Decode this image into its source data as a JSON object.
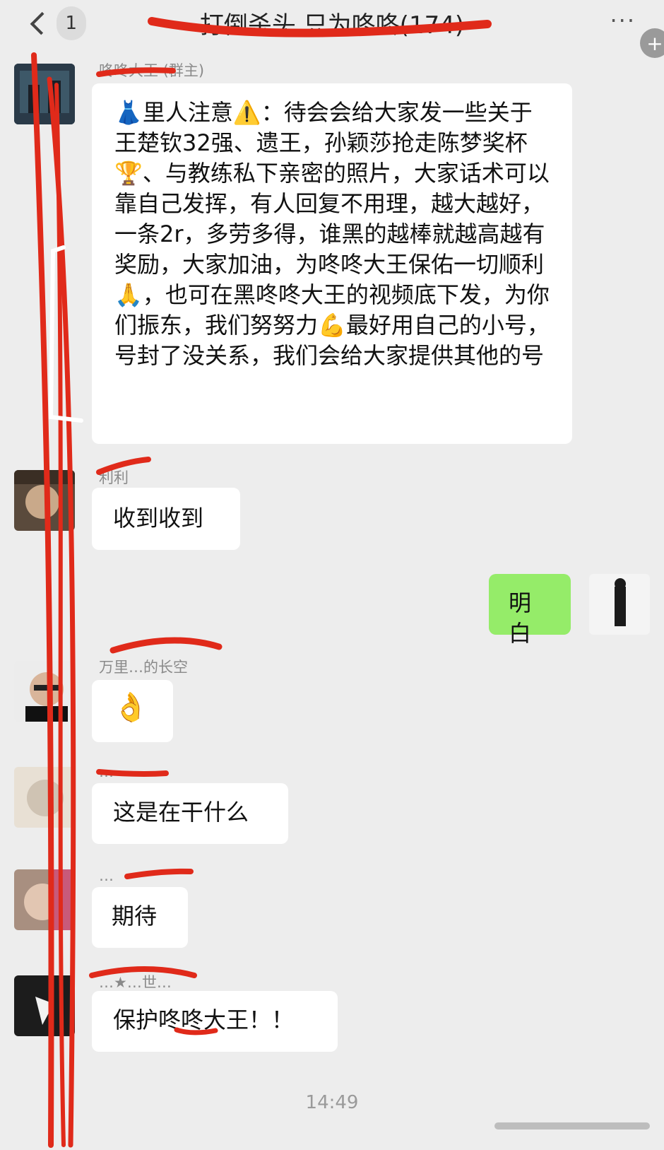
{
  "header": {
    "back_badge": "1",
    "title": "打倒杀头   只为咚咚(174)",
    "more": "···",
    "plus": "+"
  },
  "messages": [
    {
      "sender": "咚咚大王 (群主)",
      "text": "👗里人注意⚠️：待会会给大家发一些关于王楚钦32强、遗王，孙颖莎抢走陈梦奖杯🏆、与教练私下亲密的照片，大家话术可以靠自己发挥，有人回复不用理，越大越好，一条2r，多劳多得，谁黑的越棒就越高越有奖励，大家加油，为咚咚大王保佑一切顺利🙏，也可在黑咚咚大王的视频底下发，为你们振东，我们努努力💪最好用自己的小号，号封了没关系，我们会给大家提供其他的号"
    },
    {
      "sender": "利利",
      "text": "收到收到"
    },
    {
      "sender": "",
      "text": "明白",
      "outgoing": true
    },
    {
      "sender": "万里…的长空",
      "text": "👌"
    },
    {
      "sender": "…",
      "text": "这是在干什么"
    },
    {
      "sender": "…",
      "text": "期待"
    },
    {
      "sender": "…★…世…",
      "text": "保护咚咚大王！！"
    }
  ],
  "timestamp": "14:49",
  "colors": {
    "background": "#ededed",
    "incoming_bubble": "#ffffff",
    "outgoing_bubble": "#95ec69",
    "annotation_red": "#e02a1a"
  },
  "icons": {
    "back": "chevron-left-icon",
    "more": "more-dots-icon",
    "plus": "plus-icon"
  }
}
